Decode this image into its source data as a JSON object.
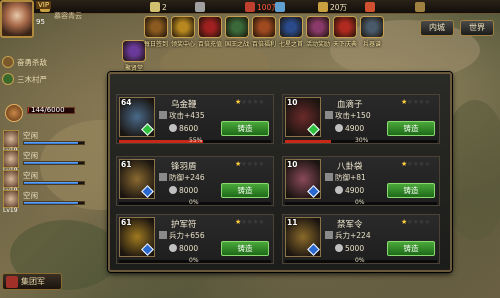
{
  "player": {
    "vip": "VIP",
    "name": "慕容青云",
    "level": "95"
  },
  "resources": [
    {
      "id": "r1",
      "value": "",
      "color": "#c8a040"
    },
    {
      "id": "r2",
      "value": "2",
      "color": "#d0c070"
    },
    {
      "id": "r3",
      "value": "",
      "color": "#a0a0a0"
    },
    {
      "id": "r4",
      "value": "100万",
      "color": "#c04030",
      "red": true
    },
    {
      "id": "r5",
      "value": "",
      "color": "#60a0d0"
    },
    {
      "id": "r6",
      "value": "20万",
      "color": "#c8a040"
    },
    {
      "id": "r7",
      "value": "",
      "color": "#d05030"
    },
    {
      "id": "r8",
      "value": "",
      "color": "#a08040"
    }
  ],
  "left_panel": {
    "quest": "奋勇杀敌",
    "tree": "三木村严",
    "troops": "144/6000",
    "troops_ratio": 0.024,
    "teams": [
      {
        "lv": "Lv19",
        "state": "空闲",
        "fill": 0.9
      },
      {
        "lv": "Lv19",
        "state": "空闲",
        "fill": 0.9
      },
      {
        "lv": "Lv19",
        "state": "空闲",
        "fill": 0.9
      },
      {
        "lv": "Lv19",
        "state": "空闲",
        "fill": 0.9
      }
    ],
    "guild": "集团军"
  },
  "features": [
    {
      "label": "聚贤堂",
      "color": "#6a3a9a"
    },
    {
      "label": "每日签到",
      "color": "#8a5a20"
    },
    {
      "label": "领奖中心",
      "color": "#b88820"
    },
    {
      "label": "百倍充值",
      "color": "#a02020"
    },
    {
      "label": "国王之战",
      "color": "#3a6a3a"
    },
    {
      "label": "百倍福利",
      "color": "#a04a20"
    },
    {
      "label": "七星之首",
      "color": "#2a4a8a"
    },
    {
      "label": "活动奖励",
      "color": "#8a3a6a"
    },
    {
      "label": "天下庆典",
      "color": "#b02a20"
    },
    {
      "label": "兵器谱",
      "color": "#4a5a6a"
    }
  ],
  "right_buttons": {
    "city": "内城",
    "world": "世界"
  },
  "modal": {
    "tabs": [
      "兵器",
      "宝石",
      "器械"
    ],
    "active_tab": 0,
    "close": "X",
    "cards": [
      {
        "level": "64",
        "name": "乌金鞭",
        "stars": 1,
        "stat_icon": "攻击",
        "stat": "攻击+435",
        "cost": "8600",
        "button": "铸造",
        "progress": 0.55,
        "pct": "55%",
        "thumb": "#4a6a8a",
        "gem": "#30c040"
      },
      {
        "level": "10",
        "name": "血滴子",
        "stars": 1,
        "stat_icon": "攻击",
        "stat": "攻击+150",
        "cost": "4900",
        "button": "铸造",
        "progress": 0.3,
        "pct": "30%",
        "thumb": "#6a2a2a",
        "gem": "#30c040"
      },
      {
        "level": "61",
        "name": "锋羽盾",
        "stars": 1,
        "stat_icon": "防御",
        "stat": "防御+246",
        "cost": "8000",
        "button": "铸造",
        "progress": 0,
        "pct": "0%",
        "thumb": "#8a6a30",
        "gem": "#2a6ad0"
      },
      {
        "level": "10",
        "name": "八卦袋",
        "stars": 1,
        "stat_icon": "防御",
        "stat": "防御+81",
        "cost": "4900",
        "button": "铸造",
        "progress": 0,
        "pct": "0%",
        "thumb": "#8a4a5a",
        "gem": "#2a6ad0"
      },
      {
        "level": "61",
        "name": "护军符",
        "stars": 1,
        "stat_icon": "兵力",
        "stat": "兵力+656",
        "cost": "8000",
        "button": "铸造",
        "progress": 0,
        "pct": "0%",
        "thumb": "#a07a20",
        "gem": "#2a6ad0"
      },
      {
        "level": "11",
        "name": "禁军令",
        "stars": 1,
        "stat_icon": "兵力",
        "stat": "兵力+224",
        "cost": "5000",
        "button": "铸造",
        "progress": 0,
        "pct": "0%",
        "thumb": "#8a6a2a",
        "gem": "#2a6ad0"
      }
    ]
  }
}
